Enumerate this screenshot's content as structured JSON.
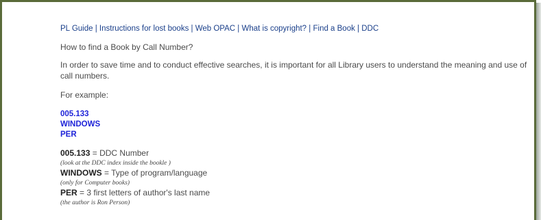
{
  "nav": {
    "links": [
      "PL Guide",
      "Instructions for lost books",
      "Web OPAC",
      "What is copyright?",
      "Find a Book",
      "DDC"
    ],
    "separator": " | "
  },
  "content": {
    "question": "How to find a Book by Call Number?",
    "intro": "In order to save time and to conduct effective searches, it is important for all Library users to understand the meaning and use of call numbers.",
    "for_example": "For example:",
    "call_number": {
      "line1": "005.133",
      "line2": "WINDOWS",
      "line3": "PER"
    },
    "definitions": [
      {
        "key": "005.133",
        "text": " = DDC Number",
        "note": "(look at the DDC index inside the bookle )"
      },
      {
        "key": "WINDOWS",
        "text": " = Type of program/language",
        "note": "(only for Computer books)"
      },
      {
        "key": "PER",
        "text": " = 3 first letters of author's last name",
        "note": "(the author is Ron Person)"
      }
    ]
  },
  "colors": {
    "frame_border": "#5a6b3a",
    "nav_link": "#1a3f8a",
    "call_number": "#1f24d9",
    "body_text": "#4a4a4a"
  }
}
